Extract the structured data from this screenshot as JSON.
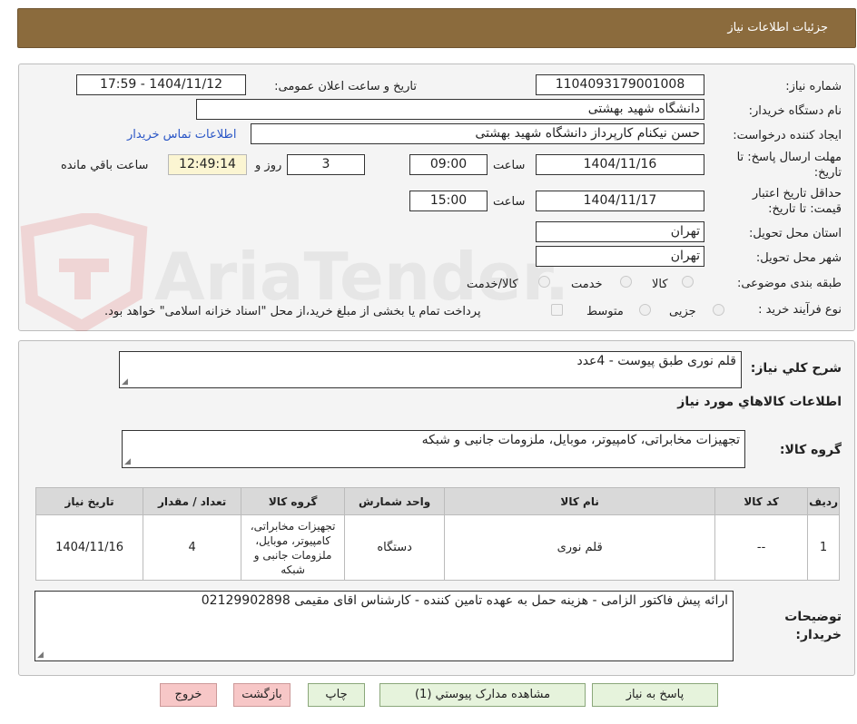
{
  "header": {
    "title": "جزئیات اطلاعات نیاز"
  },
  "form": {
    "need_number_label": "شماره نیاز:",
    "need_number": "1104093179001008",
    "announce_label": "تاریخ و ساعت اعلان عمومی:",
    "announce_value": "1404/11/12 - 17:59",
    "buyer_org_label": "نام دستگاه خریدار:",
    "buyer_org": "دانشگاه شهید بهشتی",
    "creator_label": "ایجاد کننده درخواست:",
    "creator": "حسن نیکنام کارپرداز دانشگاه شهید بهشتی",
    "contact_link": "اطلاعات تماس خریدار",
    "deadline_label": "مهلت ارسال پاسخ: تا تاریخ:",
    "deadline_date": "1404/11/16",
    "time_label": "ساعت",
    "deadline_time": "09:00",
    "days_value": "3",
    "days_label": "روز و",
    "remaining_time": "12:49:14",
    "remaining_label": "ساعت باقي مانده",
    "validity_label": "حداقل تاریخ اعتبار قیمت: تا تاریخ:",
    "validity_date": "1404/11/17",
    "validity_time": "15:00",
    "province_label": "استان محل تحویل:",
    "province": "تهران",
    "city_label": "شهر محل تحویل:",
    "city": "تهران",
    "category_label": "طبقه بندی موضوعی:",
    "category_options": [
      "کالا",
      "خدمت",
      "کالا/خدمت"
    ],
    "process_label": "نوع فرآیند خرید :",
    "process_options": [
      "جزیی",
      "متوسط"
    ],
    "payment_note": "پرداخت تمام یا بخشی از مبلغ خرید،از محل \"اسناد خزانه اسلامی\" خواهد بود."
  },
  "summary": {
    "general_desc_label": "شرح کلي نياز:",
    "general_desc": "قلم نوری طبق پیوست - 4عدد",
    "goods_info_title": "اطلاعات کالاهاي مورد نياز",
    "goods_group_label": "گروه کالا:",
    "goods_group": "تجهیزات مخابراتی، کامپیوتر، موبایل، ملزومات جانبی و شبکه"
  },
  "table": {
    "headers": [
      "رديف",
      "کد کالا",
      "نام کالا",
      "واحد شمارش",
      "گروه کالا",
      "تعداد / مقدار",
      "تاریخ نیاز"
    ],
    "rows": [
      [
        "1",
        "--",
        "قلم نوری",
        "دستگاه",
        "تجهیزات مخابراتی، کامپیوتر، موبایل، ملزومات جانبی و شبکه",
        "4",
        "1404/11/16"
      ]
    ]
  },
  "buyer_notes": {
    "label": "توضیحات خریدار:",
    "text": "ارائه پیش فاکتور الزامی  - هزینه حمل به عهده تامین کننده - کارشناس اقای مقیمی 02129902898"
  },
  "buttons": {
    "reply": "پاسخ به نیاز",
    "attachments": "مشاهده مدارک پیوستي (1)",
    "print": "چاپ",
    "back": "بازگشت",
    "exit": "خروج"
  },
  "colors": {
    "header_bg": "#8b6b3d",
    "button_green": "#e6f3dc",
    "button_pink": "#f7c7c7",
    "remaining_bg": "#fbf5d2",
    "link": "#2a56c6"
  },
  "watermark": {
    "text": "AriaTender.neT"
  }
}
